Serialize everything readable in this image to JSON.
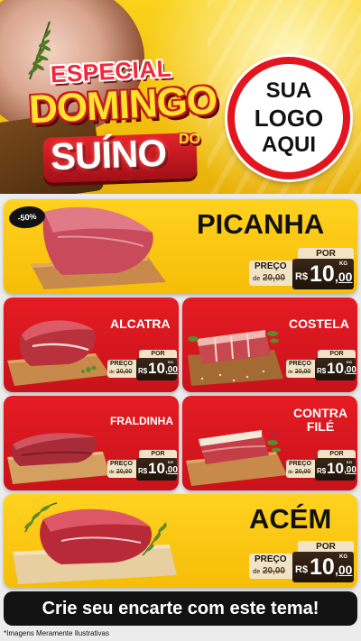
{
  "header": {
    "title_line1": "ESPECIAL",
    "title_line2": "DOMINGO",
    "title_line3": "DO",
    "title_line4": "SUÍNO",
    "logo_line1": "SUA",
    "logo_line2": "LOGO",
    "logo_line3": "AQUI"
  },
  "products": [
    {
      "name": "PICANHA",
      "badge": "-50%",
      "por": "POR",
      "preco": "PREÇO",
      "de": "de",
      "old_price": "20,00",
      "currency": "R$",
      "price_int": "10",
      "price_cents": ",00",
      "unit": "KG"
    },
    {
      "name": "ALCATRA",
      "por": "POR",
      "preco": "PREÇO",
      "de": "de",
      "old_price": "20,00",
      "currency": "R$",
      "price_int": "10",
      "price_cents": ",00",
      "unit": "KG"
    },
    {
      "name": "COSTELA",
      "por": "POR",
      "preco": "PREÇO",
      "de": "de",
      "old_price": "20,00",
      "currency": "R$",
      "price_int": "10",
      "price_cents": ",00",
      "unit": "KG"
    },
    {
      "name": "FRALDINHA",
      "por": "POR",
      "preco": "PREÇO",
      "de": "de",
      "old_price": "20,00",
      "currency": "R$",
      "price_int": "10",
      "price_cents": ",00",
      "unit": "KG"
    },
    {
      "name_line1": "CONTRA",
      "name_line2": "FILÉ",
      "por": "POR",
      "preco": "PREÇO",
      "de": "de",
      "old_price": "20,00",
      "currency": "R$",
      "price_int": "10",
      "price_cents": ",00",
      "unit": "KG"
    },
    {
      "name": "ACÉM",
      "por": "POR",
      "preco": "PREÇO",
      "de": "de",
      "old_price": "20,00",
      "currency": "R$",
      "price_int": "10",
      "price_cents": ",00",
      "unit": "KG"
    }
  ],
  "footer": {
    "cta": "Crie seu encarte com este tema!",
    "disclaimer": "*Imagens Meramente Ilustrativas"
  },
  "colors": {
    "yellow": "#f6bd08",
    "red": "#e51b22",
    "dark": "#121212"
  }
}
